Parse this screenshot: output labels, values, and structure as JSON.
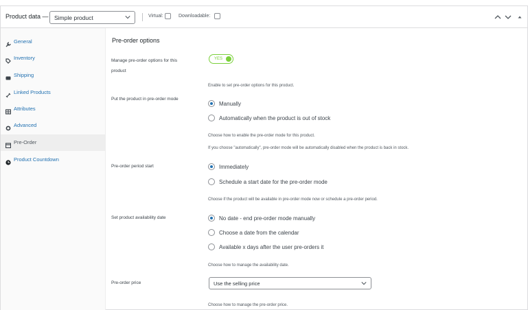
{
  "header": {
    "title": "Product data —",
    "product_type": "Simple product",
    "virtual_label": "Virtual:",
    "downloadable_label": "Downloadable:"
  },
  "sidebar": {
    "items": [
      {
        "label": "General",
        "icon": "wrench-icon"
      },
      {
        "label": "Inventory",
        "icon": "tag-icon"
      },
      {
        "label": "Shipping",
        "icon": "truck-icon"
      },
      {
        "label": "Linked Products",
        "icon": "link-icon"
      },
      {
        "label": "Attributes",
        "icon": "table-icon"
      },
      {
        "label": "Advanced",
        "icon": "gear-icon"
      },
      {
        "label": "Pre-Order",
        "icon": "calendar-icon",
        "active": true
      },
      {
        "label": "Product Countdown",
        "icon": "clock-icon"
      }
    ]
  },
  "main": {
    "section_title": "Pre-order options",
    "manage": {
      "label": "Manage pre-order options for this product",
      "toggle_text": "YES",
      "desc": "Enable to set pre-order options for this product."
    },
    "mode": {
      "label": "Put the product in pre-order mode",
      "options": [
        "Manually",
        "Automatically when the product is out of stock"
      ],
      "selected": 0,
      "desc1": "Choose how to enable the pre-order mode for this product.",
      "desc2": "If you choose \"automatically\", pre-order mode will be automatically disabled when the product is back in stock."
    },
    "period": {
      "label": "Pre-order period start",
      "options": [
        "Immediately",
        "Schedule a start date for the pre-order mode"
      ],
      "selected": 0,
      "desc": "Choose if the product will be available in pre-order mode now or schedule a pre-order period."
    },
    "availability": {
      "label": "Set product availability date",
      "options": [
        "No date - end pre-order mode manually",
        "Choose a date from the calendar",
        "Available x days after the user pre-orders it"
      ],
      "selected": 0,
      "desc": "Choose how to manage the availability date."
    },
    "price": {
      "label": "Pre-order price",
      "value": "Use the selling price",
      "desc": "Choose how to manage the pre-order price."
    }
  },
  "colors": {
    "link": "#2271b1",
    "toggle_on": "#7ad03a",
    "active_nav_bg": "#eeeeee"
  }
}
